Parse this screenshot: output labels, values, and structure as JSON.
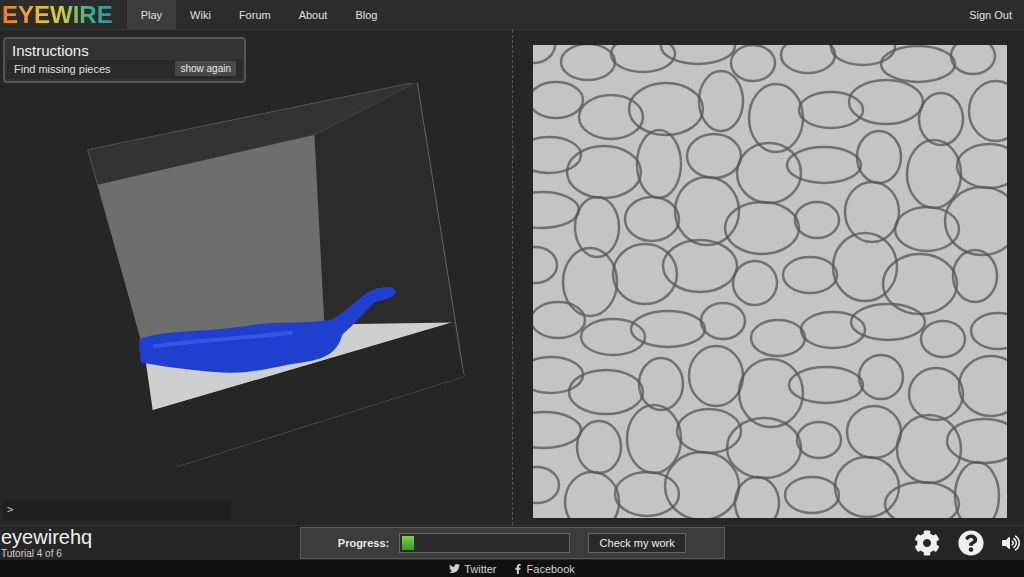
{
  "logo": "EYEWIRE",
  "nav": [
    {
      "label": "Play",
      "selected": true
    },
    {
      "label": "Wiki",
      "selected": false
    },
    {
      "label": "Forum",
      "selected": false
    },
    {
      "label": "About",
      "selected": false
    },
    {
      "label": "Blog",
      "selected": false
    }
  ],
  "account": {
    "label": "Sign Out"
  },
  "instructions": {
    "title": "Instructions",
    "text": "Find missing pieces",
    "button": "show again"
  },
  "console": {
    "prompt": ">"
  },
  "user": {
    "name": "eyewirehq",
    "tutorial": "Tutorial 4 of 6"
  },
  "progress": {
    "label": "Progress:",
    "level": 0.07,
    "button": "Check my work"
  },
  "footer": [
    {
      "label": "Twitter"
    },
    {
      "label": "Facebook"
    }
  ]
}
